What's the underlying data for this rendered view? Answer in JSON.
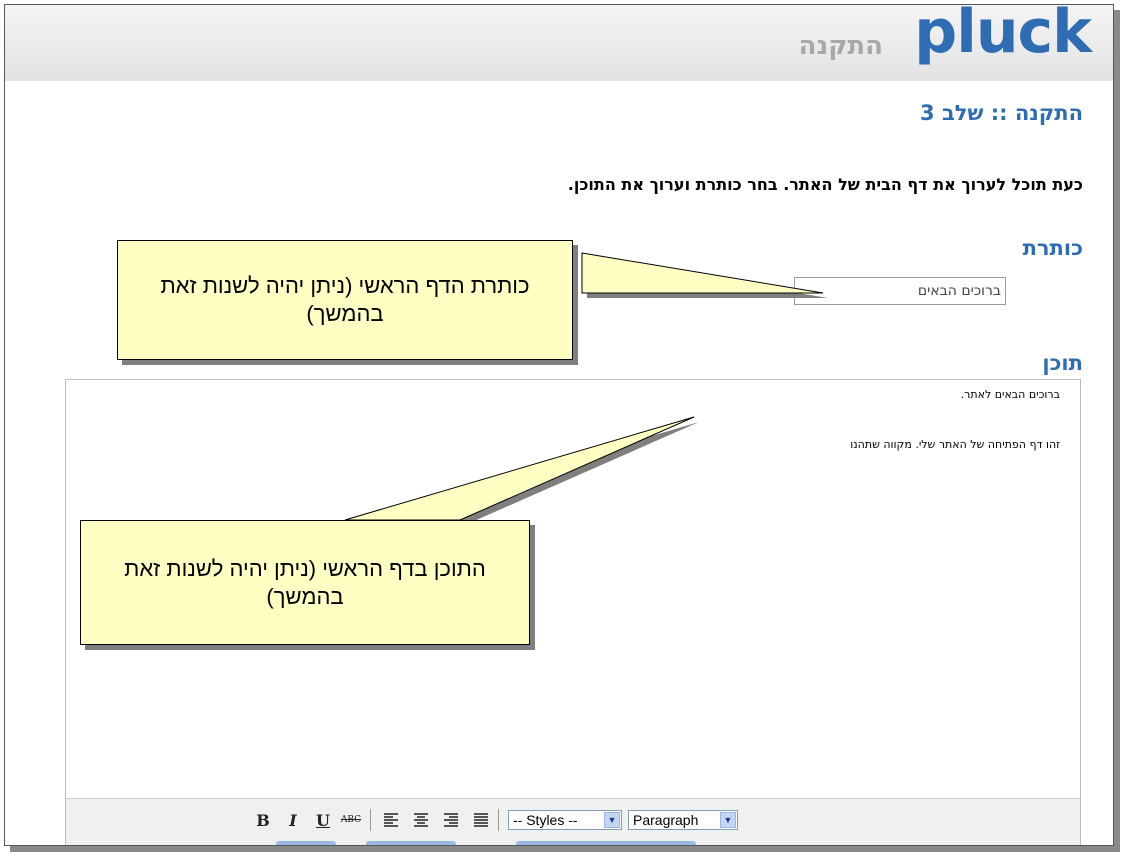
{
  "header": {
    "logo": "pluck",
    "subtitle": "התקנה"
  },
  "page": {
    "step_title": "התקנה :: שלב 3",
    "instructions": "כעת תוכל לערוך את דף הבית של האתר. בחר כותרת וערוך את התוכן."
  },
  "form": {
    "title_label": "כותרת",
    "title_value": "ברוכים הבאים",
    "content_label": "תוכן"
  },
  "editor": {
    "line1": "ברוכים הבאים לאתר.",
    "line2": "זהו דף הפתיחה של האתר שלי. מקווה שתהנו",
    "toolbar": {
      "bold": "B",
      "italic": "I",
      "underline": "U",
      "strike": "ABC",
      "styles_select": "-- Styles --",
      "format_select": "Paragraph"
    }
  },
  "callouts": {
    "title_note": "כותרת הדף הראשי (ניתן יהיה לשנות זאת בהמשך)",
    "content_note": "התוכן בדף הראשי (ניתן יהיה לשנות זאת בהמשך)"
  }
}
